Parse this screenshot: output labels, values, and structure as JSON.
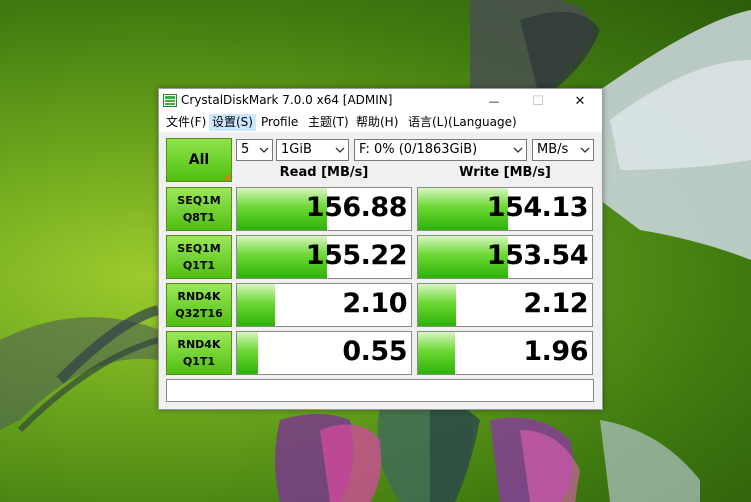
{
  "window": {
    "title": "CrystalDiskMark 7.0.0 x64 [ADMIN]",
    "controls": {
      "minimize": "—",
      "maximize": "☐",
      "close": "✕"
    }
  },
  "menu": [
    {
      "label": "文件(F)",
      "name": "menu-file"
    },
    {
      "label": "设置(S)",
      "name": "menu-settings"
    },
    {
      "label": "Profile",
      "name": "menu-profile"
    },
    {
      "label": "主题(T)",
      "name": "menu-theme"
    },
    {
      "label": "帮助(H)",
      "name": "menu-help"
    },
    {
      "label": "语言(L)(Language)",
      "name": "menu-language"
    }
  ],
  "toolbar": {
    "all_label": "All",
    "count": "5",
    "size": "1GiB",
    "drive": "F: 0% (0/1863GiB)",
    "unit": "MB/s"
  },
  "headers": {
    "read": "Read [MB/s]",
    "write": "Write [MB/s]"
  },
  "tests": [
    {
      "line1": "SEQ1M",
      "line2": "Q8T1",
      "read": "156.88",
      "write": "154.13",
      "read_fill": 0.52,
      "write_fill": 0.52
    },
    {
      "line1": "SEQ1M",
      "line2": "Q1T1",
      "read": "155.22",
      "write": "153.54",
      "read_fill": 0.52,
      "write_fill": 0.52
    },
    {
      "line1": "RND4K",
      "line2": "Q32T16",
      "read": "2.10",
      "write": "2.12",
      "read_fill": 0.22,
      "write_fill": 0.22
    },
    {
      "line1": "RND4K",
      "line2": "Q1T1",
      "read": "0.55",
      "write": "1.96",
      "read_fill": 0.12,
      "write_fill": 0.21
    }
  ],
  "comment": "",
  "colors": {
    "accent_green": "#4fbf10",
    "corner_orange": "#e07818",
    "menu_highlight": "#cce8ff"
  }
}
